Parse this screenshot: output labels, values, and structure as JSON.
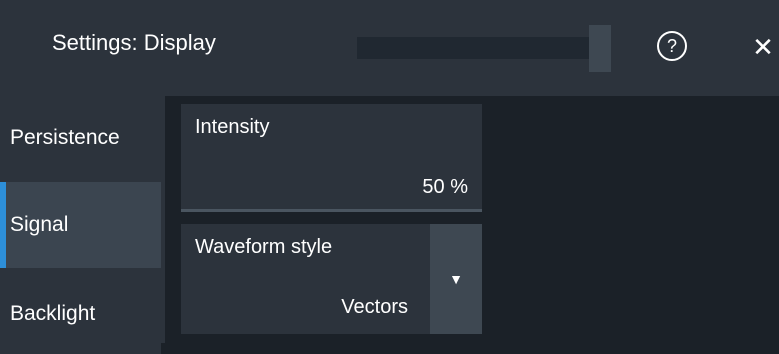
{
  "header": {
    "title": "Settings: Display",
    "slider_value": 0.92,
    "help_icon": "help-circle-icon",
    "close_icon": "close-icon",
    "help_glyph": "?",
    "close_glyph": "✕"
  },
  "sidebar": {
    "items": [
      {
        "label": "Persistence",
        "active": false
      },
      {
        "label": "Signal",
        "active": true
      },
      {
        "label": "Backlight",
        "active": false
      }
    ]
  },
  "main": {
    "intensity": {
      "label": "Intensity",
      "value": "50 %"
    },
    "waveform_style": {
      "label": "Waveform style",
      "value": "Vectors",
      "dropdown_glyph": "▼"
    }
  },
  "colors": {
    "accent": "#2d8fd9",
    "background": "#1b2128",
    "panel": "#2c333c"
  }
}
